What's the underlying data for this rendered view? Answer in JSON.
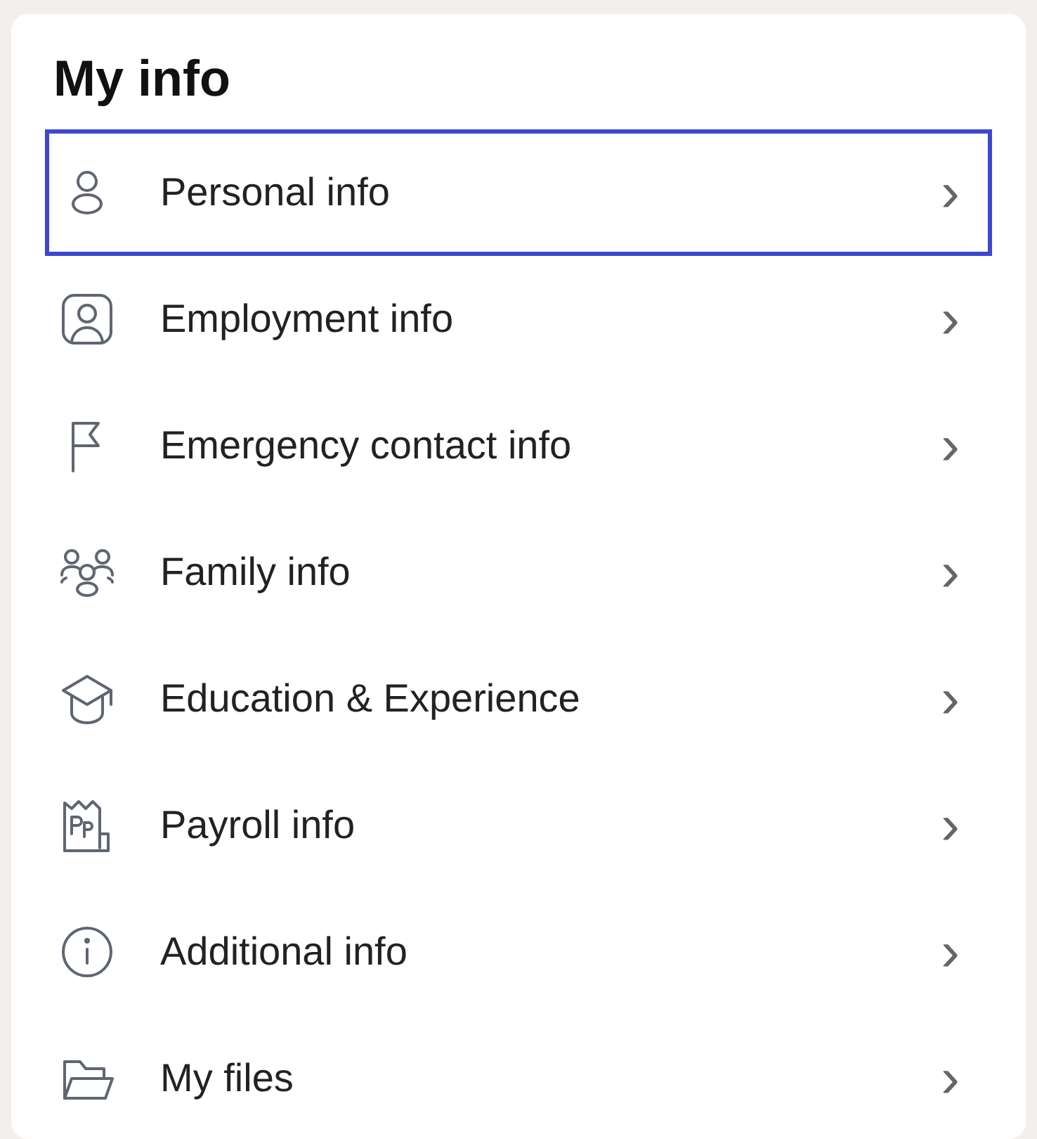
{
  "title": "My info",
  "items": [
    {
      "label": "Personal info",
      "chevron": "›",
      "selected": true
    },
    {
      "label": "Employment info",
      "chevron": "›",
      "selected": false
    },
    {
      "label": "Emergency contact info",
      "chevron": "›",
      "selected": false
    },
    {
      "label": "Family info",
      "chevron": "›",
      "selected": false
    },
    {
      "label": "Education & Experience",
      "chevron": "›",
      "selected": false
    },
    {
      "label": "Payroll info",
      "chevron": "›",
      "selected": false
    },
    {
      "label": "Additional info",
      "chevron": "›",
      "selected": false
    },
    {
      "label": "My files",
      "chevron": "›",
      "selected": false
    }
  ]
}
